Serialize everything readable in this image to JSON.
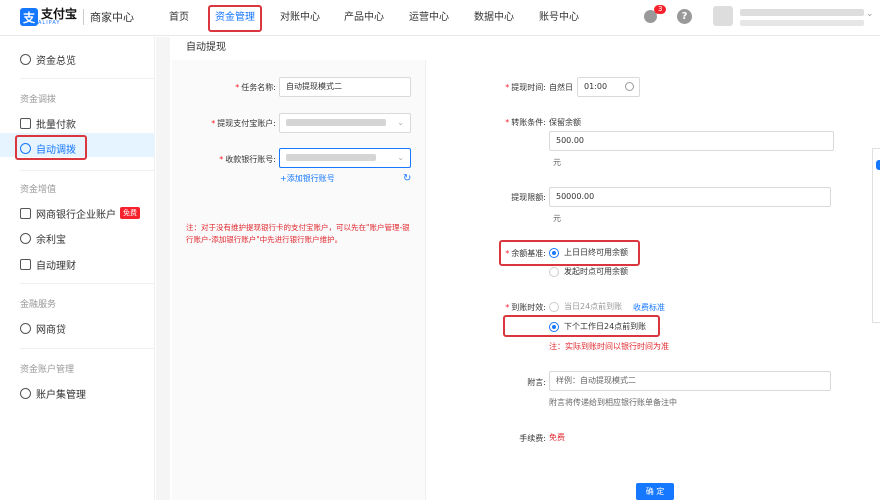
{
  "header": {
    "logo_cn": "支付宝",
    "logo_en": "ALIPAY",
    "logo_mark": "支",
    "sub": "商家中心",
    "nav": [
      "首页",
      "资金管理",
      "对账中心",
      "产品中心",
      "运营中心",
      "数据中心",
      "账号中心"
    ],
    "active_nav": "资金管理",
    "badge": "3",
    "help": "?"
  },
  "sidebar": {
    "overview": "资金总览",
    "group1": "资金调拨",
    "batch_pay": "批量付款",
    "auto_transfer": "自动调拨",
    "group2": "资金增值",
    "mybank_account": "网商银行企业账户",
    "free_tag": "免费",
    "yuelibao": "余利宝",
    "auto_finance": "自动理财",
    "group3": "金融服务",
    "mybank_loan": "网商贷",
    "group4": "资金账户管理",
    "account_set": "账户集管理"
  },
  "form": {
    "title": "自动提现",
    "task_name_label": "任务名称:",
    "task_name_value": "自动提现模式二",
    "alipay_account_label": "提现支付宝账户:",
    "bank_account_label": "收款银行账号:",
    "add_bank": "+添加银行账号",
    "note": "注：对于没有维护提现银行卡的支付宝账户，可以先在\"账户管理-银行账户-添加银行账户\"中先进行银行账户维护。",
    "withdraw_time_label": "提现时间:",
    "withdraw_time_unit": "自然日",
    "withdraw_time_value": "01:00",
    "transfer_cond_label": "转账条件:",
    "transfer_cond_value": "保留余额",
    "reserve_amount": "500.00",
    "yuan1": "元",
    "limit_label": "提现限额:",
    "limit_value": "50000.00",
    "yuan2": "元",
    "balance_base_label": "余额基准:",
    "balance_opt1": "上日日终可用余额",
    "balance_opt2": "发起时点可用余额",
    "arrival_label": "到账时效:",
    "arrival_opt1": "当日24点前到账",
    "fee_std": "收费标准",
    "arrival_opt2": "下个工作日24点前到账",
    "arrival_note": "注：实际到账时间以银行时间为准",
    "memo_label": "附言:",
    "memo_placeholder": "样例：自动提现模式二",
    "memo_hint": "附言将传递给到相应银行账单备注中",
    "fee_label": "手续费:",
    "fee_value": "免费",
    "confirm": "确 定"
  },
  "colors": {
    "accent": "#1677ff",
    "highlight": "#d9363e",
    "danger": "#f5222d"
  }
}
